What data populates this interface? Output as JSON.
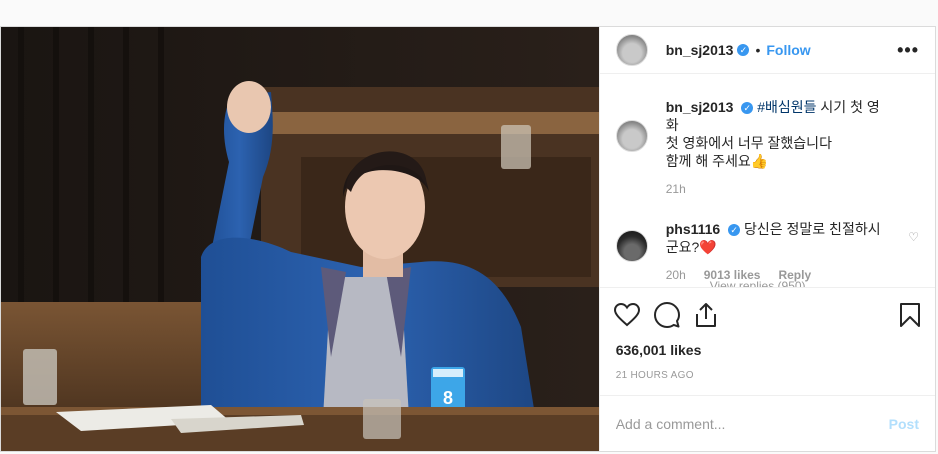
{
  "header": {
    "username": "bn_sj2013",
    "separator": "•",
    "follow_label": "Follow",
    "more_label": "•••"
  },
  "caption": {
    "username": "bn_sj2013",
    "hashtag": "#배심원들",
    "text_after_tag": " 시기 첫 영화",
    "line2": "첫 영화에서 너무 잘했습니다",
    "line3": "함께 해 주세요👍",
    "time": "21h"
  },
  "comment": {
    "username": "phs1116",
    "text": "당신은 정말로 친절하시군요?❤️",
    "time": "20h",
    "likes": "9013 likes",
    "reply_label": "Reply",
    "view_replies": "View replies (950)"
  },
  "likes_count": "636,001 likes",
  "timestamp": "21 HOURS AGO",
  "add_comment": {
    "placeholder": "Add a comment...",
    "post_label": "Post"
  },
  "media": {
    "badge_number": "8"
  },
  "icons": {
    "verified": "verified-badge-icon",
    "like": "heart-icon",
    "comment": "comment-icon",
    "share": "share-icon",
    "save": "bookmark-icon"
  },
  "colors": {
    "link_blue": "#3897f0",
    "post_disabled": "#b2dffc",
    "muted": "#999999"
  }
}
